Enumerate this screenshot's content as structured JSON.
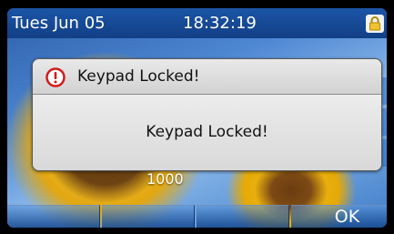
{
  "status_bar": {
    "date": "Tues Jun 05",
    "time": "18:32:19",
    "icon": "lock-icon"
  },
  "dialog": {
    "icon": "alert-icon",
    "title": "Keypad Locked!",
    "message": "Keypad Locked!"
  },
  "account": {
    "label": "1000"
  },
  "softkeys": [
    "",
    "",
    "",
    "OK"
  ],
  "colors": {
    "status_bar": "#1b55a6",
    "alert_red": "#d41b1b",
    "dialog_bg": "#dcdcdc"
  }
}
